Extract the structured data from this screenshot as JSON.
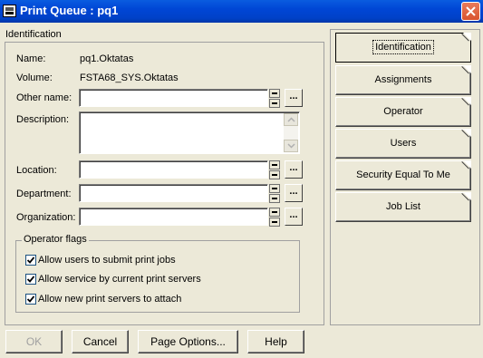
{
  "window": {
    "title": "Print Queue : pq1"
  },
  "identification": {
    "group_label": "Identification",
    "name_label": "Name:",
    "name_value": "pq1.Oktatas",
    "volume_label": "Volume:",
    "volume_value": "FSTA68_SYS.Oktatas",
    "other_name_label": "Other name:",
    "other_name_value": "",
    "description_label": "Description:",
    "description_value": "",
    "location_label": "Location:",
    "location_value": "",
    "department_label": "Department:",
    "department_value": "",
    "organization_label": "Organization:",
    "organization_value": "",
    "ellipsis_label": "..."
  },
  "operator_flags": {
    "group_label": "Operator flags",
    "flags": [
      {
        "label": "Allow users to submit print jobs",
        "checked": true
      },
      {
        "label": "Allow service by current print servers",
        "checked": true
      },
      {
        "label": "Allow new print servers to attach",
        "checked": true
      }
    ]
  },
  "tabs": [
    {
      "label": "Identification",
      "active": true
    },
    {
      "label": "Assignments",
      "active": false
    },
    {
      "label": "Operator",
      "active": false
    },
    {
      "label": "Users",
      "active": false
    },
    {
      "label": "Security Equal To Me",
      "active": false
    },
    {
      "label": "Job List",
      "active": false
    }
  ],
  "buttons": {
    "ok": "OK",
    "cancel": "Cancel",
    "page_options": "Page Options...",
    "help": "Help"
  },
  "colors": {
    "title_bar": "#0046d5",
    "dialog_bg": "#ece9d8",
    "close_button": "#d9542f"
  }
}
